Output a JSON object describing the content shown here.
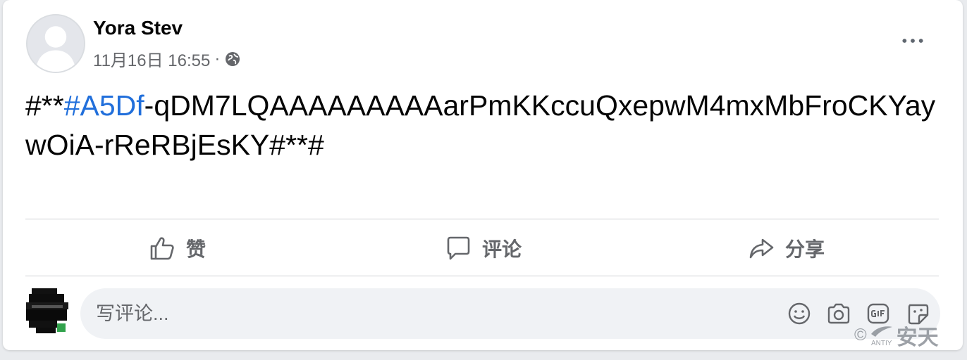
{
  "post": {
    "author": "Yora Stev",
    "timestamp": "11月16日 16:55",
    "separator": "·",
    "privacy_icon": "globe-icon",
    "text_prefix": "#**",
    "hashtag": "#A5Df",
    "text_rest": "-qDM7LQAAAAAAAAAarPmKKccuQxepwM4mxMbFroCKYaywOiA-rReRBjEsKY#**#"
  },
  "actions": {
    "like_label": "赞",
    "comment_label": "评论",
    "share_label": "分享"
  },
  "comment_box": {
    "placeholder": "写评论..."
  },
  "watermark": {
    "symbol": "©",
    "brand_small": "ANTIY",
    "brand": "安天"
  },
  "colors": {
    "hashtag": "#216fdb",
    "text": "#050505",
    "muted": "#65676b"
  }
}
